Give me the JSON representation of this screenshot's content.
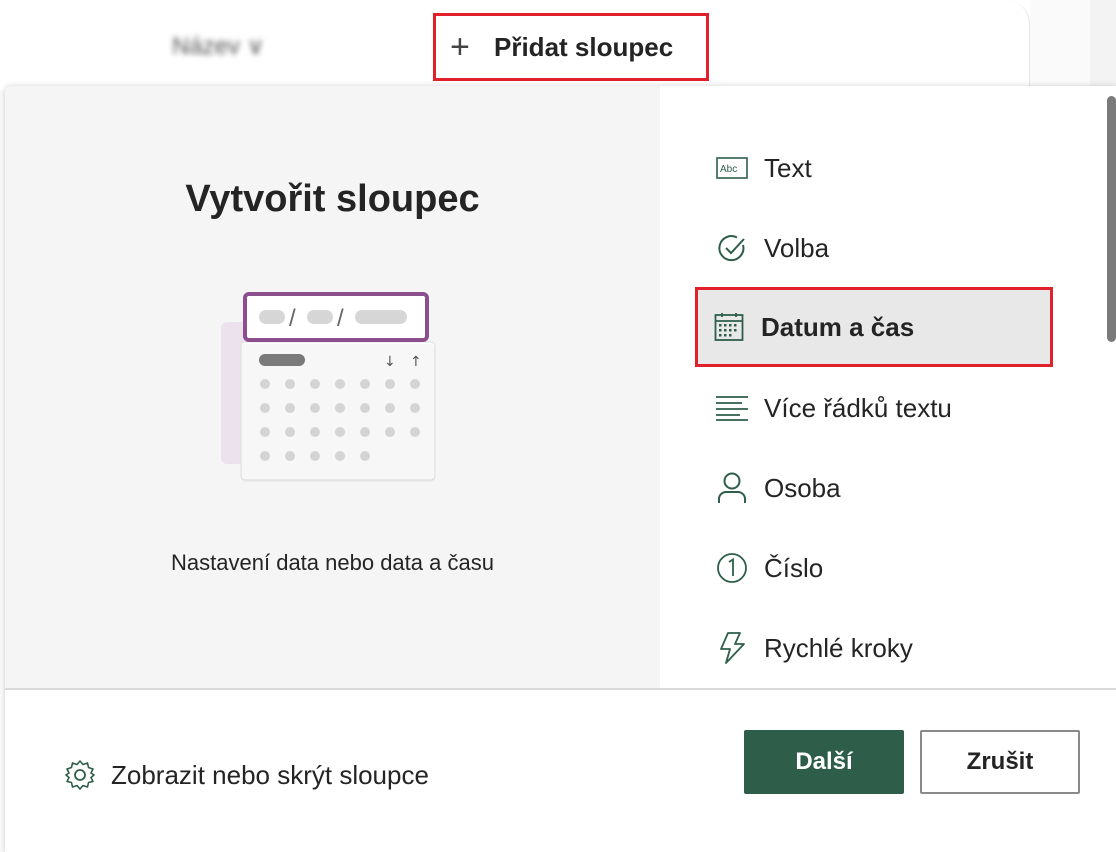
{
  "header": {
    "blurred_column": "Název ∨",
    "add_column_label": "Přidat sloupec"
  },
  "dialog": {
    "title": "Vytvořit sloupec",
    "description": "Nastavení data nebo data a času",
    "column_types": [
      {
        "label": "Text",
        "icon": "text-abc-icon",
        "selected": false
      },
      {
        "label": "Volba",
        "icon": "check-circle-icon",
        "selected": false
      },
      {
        "label": "Datum a čas",
        "icon": "calendar-icon",
        "selected": true
      },
      {
        "label": "Více řádků textu",
        "icon": "multiline-text-icon",
        "selected": false
      },
      {
        "label": "Osoba",
        "icon": "person-icon",
        "selected": false
      },
      {
        "label": "Číslo",
        "icon": "number-one-icon",
        "selected": false
      },
      {
        "label": "Rychlé kroky",
        "icon": "lightning-icon",
        "selected": false
      }
    ],
    "footer": {
      "toggle_columns_label": "Zobrazit nebo skrýt sloupce",
      "next_label": "Další",
      "cancel_label": "Zrušit"
    }
  },
  "colors": {
    "accent": "#2e5e4a",
    "highlight_border": "#e0202b",
    "illustration_purple": "#8a4f8c"
  }
}
